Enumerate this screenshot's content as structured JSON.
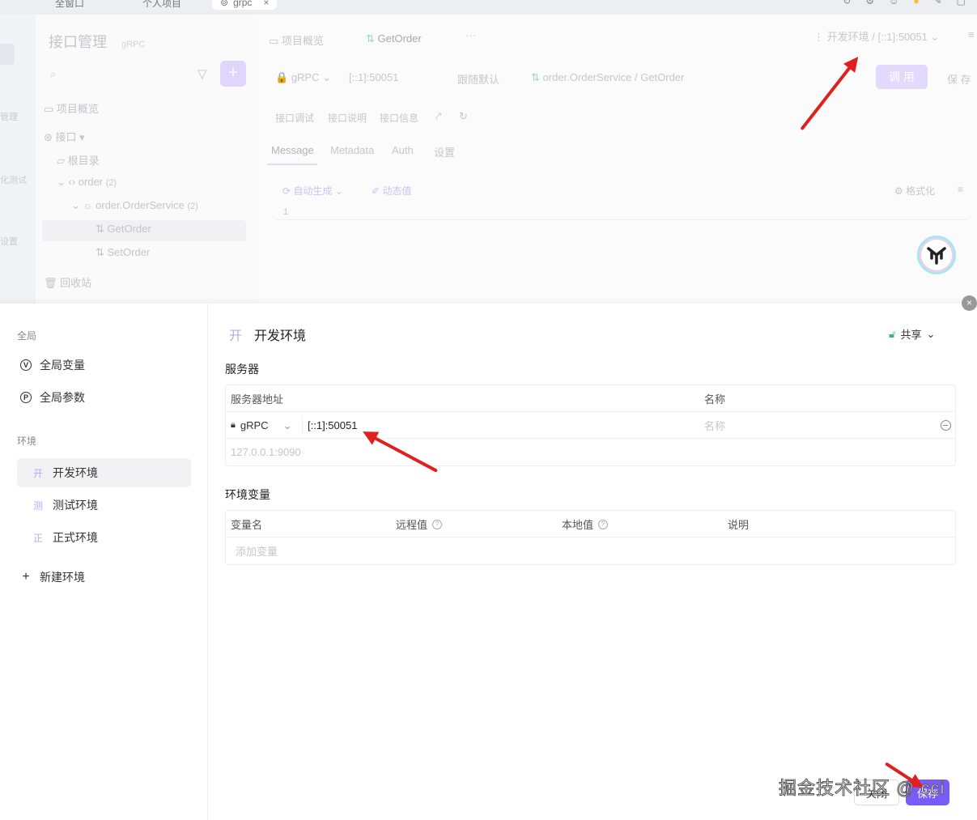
{
  "top_tabs": [
    {
      "label": "全窗口"
    },
    {
      "label": "个人项目"
    },
    {
      "label": "grpc",
      "close": "×"
    }
  ],
  "left_rail": [
    "管理",
    "化测试",
    "设置"
  ],
  "tree": {
    "title": "接口管理",
    "subtitle": "gRPC",
    "items": [
      {
        "label": "项目概览"
      },
      {
        "label": "接口"
      },
      {
        "label": "根目录"
      },
      {
        "label": "order",
        "count": "(2)"
      },
      {
        "label": "order.OrderService",
        "count": "(2)"
      },
      {
        "label": "GetOrder"
      },
      {
        "label": "SetOrder"
      },
      {
        "label": "回收站"
      }
    ]
  },
  "main_bg": {
    "tab_overview": "项目概览",
    "tab_getorder": "GetOrder",
    "env_selector": "开发环境 / [::1]:50051",
    "protocol": "gRPC",
    "address": "[::1]:50051",
    "follow_default": "跟随默认",
    "method_path": "order.OrderService / GetOrder",
    "call_button": "调 用",
    "save_button": "保 存",
    "subtabs": [
      "接口调试",
      "接口说明",
      "接口信息"
    ],
    "msg_tabs": [
      "Message",
      "Metadata",
      "Auth",
      "设置"
    ],
    "auto_gen": "自动生成",
    "dynamic_value": "动态值",
    "format": "格式化",
    "line_no": "1"
  },
  "modal": {
    "close": "×",
    "sidebar": {
      "global_section": "全局",
      "global_vars": "全局变量",
      "global_params": "全局参数",
      "env_section": "环境",
      "envs": [
        {
          "badge": "开",
          "label": "开发环境",
          "active": true
        },
        {
          "badge": "测",
          "label": "测试环境",
          "active": false
        },
        {
          "badge": "正",
          "label": "正式环境",
          "active": false
        }
      ],
      "new_env": "新建环境"
    },
    "env": {
      "badge": "开",
      "name": "开发环境",
      "share": "共享"
    },
    "server": {
      "heading": "服务器",
      "col_address": "服务器地址",
      "col_name": "名称",
      "protocol": "gRPC",
      "address": "[::1]:50051",
      "name_placeholder": "名称",
      "new_placeholder": "127.0.0.1:9090"
    },
    "variables": {
      "heading": "环境变量",
      "columns": [
        "变量名",
        "远程值",
        "本地值",
        "说明"
      ],
      "add_placeholder": "添加变量"
    },
    "footer": {
      "cancel": "关闭",
      "save": "保存"
    }
  },
  "watermark": "掘金技术社区 @ cci",
  "colors": {
    "accent": "#7a5af8",
    "arrow": "#e21f1f",
    "share_lock": "#3cb96a"
  }
}
